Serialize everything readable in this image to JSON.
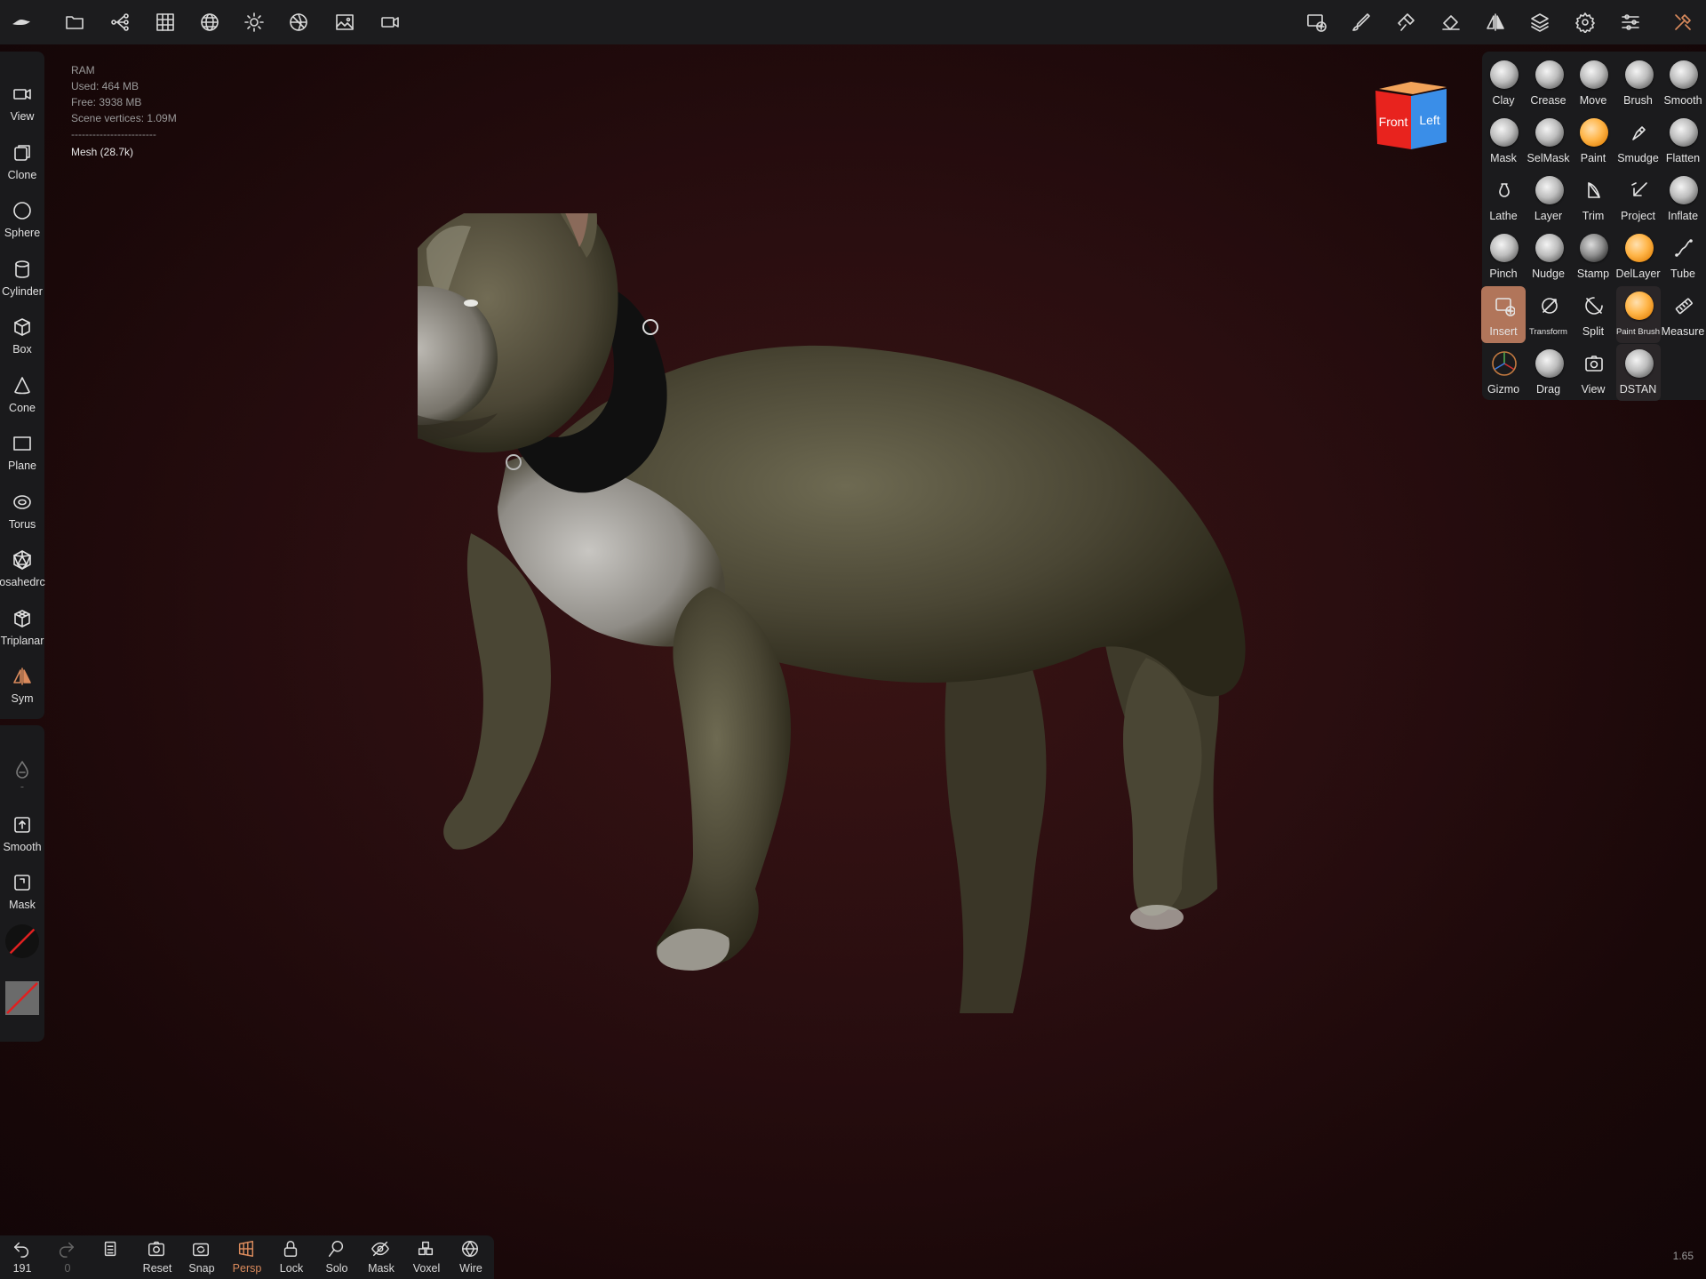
{
  "topbar": {
    "icons": [
      "app-logo-icon",
      "folder-icon",
      "scene-tree-icon",
      "grid-icon",
      "sphere-mesh-icon",
      "light-icon",
      "material-icon",
      "image-icon",
      "camera-icon",
      "add-view-icon",
      "brush-icon",
      "paint-tool-icon",
      "paint-bucket-icon",
      "symmetry-icon",
      "layers-icon",
      "settings-icon",
      "sliders-icon",
      "tools-icon"
    ]
  },
  "left_tools": [
    {
      "label": "View",
      "icon": "camera-icon"
    },
    {
      "label": "Clone",
      "icon": "clone-icon"
    },
    {
      "label": "Sphere",
      "icon": "sphere-icon"
    },
    {
      "label": "Cylinder",
      "icon": "cylinder-icon"
    },
    {
      "label": "Box",
      "icon": "box-icon"
    },
    {
      "label": "Cone",
      "icon": "cone-icon"
    },
    {
      "label": "Plane",
      "icon": "plane-icon"
    },
    {
      "label": "Torus",
      "icon": "torus-icon"
    },
    {
      "label": "osahedrc",
      "icon": "icosahedron-icon"
    },
    {
      "label": "Triplanar",
      "icon": "triplanar-icon"
    },
    {
      "label": "Sym",
      "icon": "symmetry-icon"
    }
  ],
  "left_tools2": [
    {
      "label": "-",
      "icon": "drop-icon"
    },
    {
      "label": "Smooth",
      "icon": "smooth-icon"
    },
    {
      "label": "Mask",
      "icon": "mask-icon"
    }
  ],
  "info": {
    "title": "RAM",
    "used": "Used: 464 MB",
    "free": "Free: 3938 MB",
    "vertices": "Scene vertices: 1.09M",
    "separator": "------------------------",
    "mesh": "Mesh (28.7k)"
  },
  "cube": {
    "front": "Front",
    "left": "Left",
    "front_color": "#e8231e",
    "left_color": "#3a8ee8"
  },
  "right_tools": [
    {
      "label": "Clay",
      "kind": "ball"
    },
    {
      "label": "Crease",
      "kind": "ball"
    },
    {
      "label": "Move",
      "kind": "ball"
    },
    {
      "label": "Brush",
      "kind": "ball"
    },
    {
      "label": "Smooth",
      "kind": "ball"
    },
    {
      "label": "Mask",
      "kind": "ball"
    },
    {
      "label": "SelMask",
      "kind": "ball"
    },
    {
      "label": "Paint",
      "kind": "orange"
    },
    {
      "label": "Smudge",
      "kind": "icon"
    },
    {
      "label": "Flatten",
      "kind": "ball"
    },
    {
      "label": "Lathe",
      "kind": "icon"
    },
    {
      "label": "Layer",
      "kind": "ball"
    },
    {
      "label": "Trim",
      "kind": "icon"
    },
    {
      "label": "Project",
      "kind": "icon"
    },
    {
      "label": "Inflate",
      "kind": "ball"
    },
    {
      "label": "Pinch",
      "kind": "ball"
    },
    {
      "label": "Nudge",
      "kind": "ball"
    },
    {
      "label": "Stamp",
      "kind": "dark"
    },
    {
      "label": "DelLayer",
      "kind": "orange"
    },
    {
      "label": "Tube",
      "kind": "icon"
    },
    {
      "label": "Insert",
      "kind": "icon",
      "selected": true
    },
    {
      "label": "Transform",
      "kind": "icon"
    },
    {
      "label": "Split",
      "kind": "icon"
    },
    {
      "label": "Paint Brush",
      "kind": "orange"
    },
    {
      "label": "Measure",
      "kind": "icon"
    },
    {
      "label": "Gizmo",
      "kind": "icon"
    },
    {
      "label": "Drag",
      "kind": "ball"
    },
    {
      "label": "View",
      "kind": "icon"
    },
    {
      "label": "DSTAN",
      "kind": "ball"
    }
  ],
  "bottom_tools": [
    {
      "label": "191",
      "icon": "undo-icon"
    },
    {
      "label": "0",
      "icon": "redo-icon"
    },
    {
      "label": "",
      "icon": "scene-list-icon"
    },
    {
      "label": "Reset",
      "icon": "reset-camera-icon"
    },
    {
      "label": "Snap",
      "icon": "snap-icon"
    },
    {
      "label": "Persp",
      "icon": "perspective-icon"
    },
    {
      "label": "Lock",
      "icon": "lock-icon"
    },
    {
      "label": "Solo",
      "icon": "solo-icon"
    },
    {
      "label": "Mask",
      "icon": "hide-icon"
    },
    {
      "label": "Voxel",
      "icon": "voxel-icon"
    },
    {
      "label": "Wire",
      "icon": "wireframe-icon"
    }
  ],
  "zoom": "1.65",
  "colors": {
    "accent": "#d98a5c",
    "selected_tool": "#b1755a"
  }
}
